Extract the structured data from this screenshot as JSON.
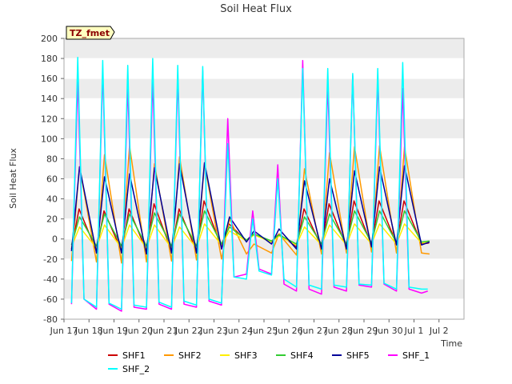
{
  "chart_data": {
    "type": "line",
    "title": "Soil Heat Flux",
    "xlabel": "Time",
    "ylabel": "Soil Heat Flux",
    "site_badge": "TZ_fmet",
    "ylim": [
      -80,
      200
    ],
    "yticks": [
      -80,
      -60,
      -40,
      -20,
      0,
      20,
      40,
      60,
      80,
      100,
      120,
      140,
      160,
      180,
      200
    ],
    "xlim": [
      16,
      32
    ],
    "xticks": [
      {
        "x": 16,
        "label": "Jun 17"
      },
      {
        "x": 17,
        "label": "Jun 18"
      },
      {
        "x": 18,
        "label": "Jun 19"
      },
      {
        "x": 19,
        "label": "Jun 20"
      },
      {
        "x": 20,
        "label": "Jun 21"
      },
      {
        "x": 21,
        "label": "Jun 22"
      },
      {
        "x": 22,
        "label": "Jun 23"
      },
      {
        "x": 23,
        "label": "Jun 24"
      },
      {
        "x": 24,
        "label": "Jun 25"
      },
      {
        "x": 25,
        "label": "Jun 26"
      },
      {
        "x": 26,
        "label": "Jun 27"
      },
      {
        "x": 27,
        "label": "Jun 28"
      },
      {
        "x": 28,
        "label": "Jun 29"
      },
      {
        "x": 29,
        "label": "Jun 30"
      },
      {
        "x": 30,
        "label": "Jul 1"
      },
      {
        "x": 31,
        "label": "Jul 2"
      }
    ],
    "grid": true,
    "legend_position": "bottom",
    "x_unit": "days since Jun 16",
    "series": [
      {
        "name": "SHF1",
        "color": "#cc0000",
        "x": [
          16.3,
          16.6,
          17.3,
          17.6,
          18.3,
          18.6,
          19.3,
          19.6,
          20.3,
          20.6,
          21.3,
          21.6,
          22.3,
          22.6,
          23.3,
          23.6,
          24.3,
          24.6,
          25.3,
          25.6,
          26.3,
          26.6,
          27.3,
          27.6,
          28.3,
          28.6,
          29.3,
          29.6,
          30.3,
          30.6
        ],
        "values": [
          -10,
          30,
          -12,
          28,
          -12,
          30,
          -12,
          35,
          -12,
          30,
          -12,
          38,
          -8,
          15,
          -2,
          5,
          -3,
          5,
          -8,
          30,
          -8,
          35,
          -8,
          38,
          -6,
          38,
          -5,
          38,
          -5,
          -4
        ]
      },
      {
        "name": "SHF2",
        "color": "#ff9900",
        "x": [
          16.3,
          16.62,
          17.3,
          17.62,
          18.3,
          18.62,
          19.3,
          19.62,
          20.3,
          20.62,
          21.3,
          21.62,
          22.3,
          22.62,
          23.3,
          23.6,
          24.3,
          24.6,
          25.3,
          25.62,
          26.3,
          26.62,
          27.3,
          27.62,
          28.3,
          28.62,
          29.3,
          29.62,
          30.3,
          30.62
        ],
        "values": [
          -22,
          72,
          -23,
          84,
          -24,
          93,
          -23,
          75,
          -22,
          82,
          -21,
          75,
          -20,
          20,
          -15,
          -5,
          -14,
          5,
          -16,
          70,
          -15,
          86,
          -14,
          92,
          -13,
          93,
          -14,
          92,
          -14,
          -15
        ]
      },
      {
        "name": "SHF3",
        "color": "#ffee00",
        "x": [
          16.3,
          16.62,
          17.3,
          17.62,
          18.3,
          18.62,
          19.3,
          19.62,
          20.3,
          20.62,
          21.3,
          21.62,
          22.3,
          22.62,
          23.3,
          23.6,
          24.3,
          24.6,
          25.3,
          25.62,
          26.3,
          26.62,
          27.3,
          27.62,
          28.3,
          28.62,
          29.3,
          29.62,
          30.3,
          30.62
        ],
        "values": [
          -8,
          12,
          -9,
          14,
          -9,
          14,
          -9,
          14,
          -9,
          12,
          -9,
          15,
          -6,
          8,
          -2,
          4,
          -3,
          3,
          -6,
          12,
          -6,
          14,
          -6,
          15,
          -5,
          15,
          -5,
          15,
          -4,
          -3
        ]
      },
      {
        "name": "SHF4",
        "color": "#33cc33",
        "x": [
          16.3,
          16.62,
          17.3,
          17.62,
          18.3,
          18.62,
          19.3,
          19.62,
          20.3,
          20.62,
          21.3,
          21.62,
          22.3,
          22.62,
          23.3,
          23.6,
          24.3,
          24.6,
          25.3,
          25.62,
          26.3,
          26.62,
          27.3,
          27.62,
          28.3,
          28.62,
          29.3,
          29.62,
          30.3,
          30.62
        ],
        "values": [
          -6,
          22,
          -7,
          25,
          -7,
          25,
          -7,
          26,
          -7,
          25,
          -7,
          28,
          -5,
          12,
          -1,
          5,
          -2,
          4,
          -5,
          22,
          -5,
          25,
          -5,
          28,
          -4,
          28,
          -4,
          28,
          -3,
          -2
        ]
      },
      {
        "name": "SHF5",
        "color": "#000099",
        "x": [
          16.3,
          16.62,
          17.3,
          17.62,
          18.3,
          18.62,
          19.3,
          19.62,
          20.3,
          20.62,
          21.3,
          21.62,
          22.3,
          22.62,
          23.3,
          23.6,
          24.3,
          24.6,
          25.3,
          25.62,
          26.3,
          26.62,
          27.3,
          27.62,
          28.3,
          28.62,
          29.3,
          29.62,
          30.3,
          30.62
        ],
        "values": [
          -12,
          72,
          -14,
          62,
          -14,
          65,
          -15,
          71,
          -14,
          75,
          -14,
          76,
          -10,
          22,
          -3,
          8,
          -5,
          10,
          -10,
          58,
          -10,
          60,
          -10,
          68,
          -8,
          72,
          -6,
          73,
          -6,
          -3
        ]
      },
      {
        "name": "SHF_1",
        "color": "#ff00ff",
        "x": [
          16.3,
          16.55,
          16.8,
          17.3,
          17.55,
          17.8,
          18.3,
          18.55,
          18.8,
          19.3,
          19.55,
          19.8,
          20.3,
          20.55,
          20.8,
          21.3,
          21.55,
          21.8,
          22.3,
          22.55,
          22.8,
          23.3,
          23.55,
          23.8,
          24.3,
          24.55,
          24.8,
          25.3,
          25.55,
          25.8,
          26.3,
          26.55,
          26.8,
          27.3,
          27.55,
          27.8,
          28.3,
          28.55,
          28.8,
          29.3,
          29.55,
          29.8,
          30.3,
          30.55
        ],
        "values": [
          -65,
          160,
          -60,
          -70,
          168,
          -65,
          -72,
          155,
          -68,
          -70,
          160,
          -65,
          -70,
          162,
          -65,
          -68,
          168,
          -62,
          -66,
          120,
          -38,
          -35,
          28,
          -30,
          -35,
          74,
          -45,
          -52,
          178,
          -50,
          -55,
          155,
          -48,
          -52,
          163,
          -46,
          -48,
          160,
          -45,
          -52,
          150,
          -50,
          -54,
          -52
        ]
      },
      {
        "name": "SHF_2",
        "color": "#00ffff",
        "x": [
          16.3,
          16.55,
          16.8,
          17.3,
          17.55,
          17.8,
          18.3,
          18.55,
          18.8,
          19.3,
          19.55,
          19.8,
          20.3,
          20.55,
          20.8,
          21.3,
          21.55,
          21.8,
          22.3,
          22.55,
          22.8,
          23.3,
          23.55,
          23.8,
          24.3,
          24.55,
          24.8,
          25.3,
          25.55,
          25.8,
          26.3,
          26.55,
          26.8,
          27.3,
          27.55,
          27.8,
          28.3,
          28.55,
          28.8,
          29.3,
          29.55,
          29.8,
          30.3,
          30.55
        ],
        "values": [
          -64,
          181,
          -60,
          -68,
          178,
          -64,
          -70,
          173,
          -66,
          -68,
          180,
          -63,
          -68,
          173,
          -62,
          -66,
          172,
          -60,
          -64,
          95,
          -38,
          -40,
          20,
          -32,
          -36,
          60,
          -40,
          -48,
          170,
          -46,
          -50,
          170,
          -46,
          -48,
          165,
          -45,
          -46,
          170,
          -44,
          -50,
          176,
          -48,
          -50,
          -50
        ]
      }
    ]
  }
}
